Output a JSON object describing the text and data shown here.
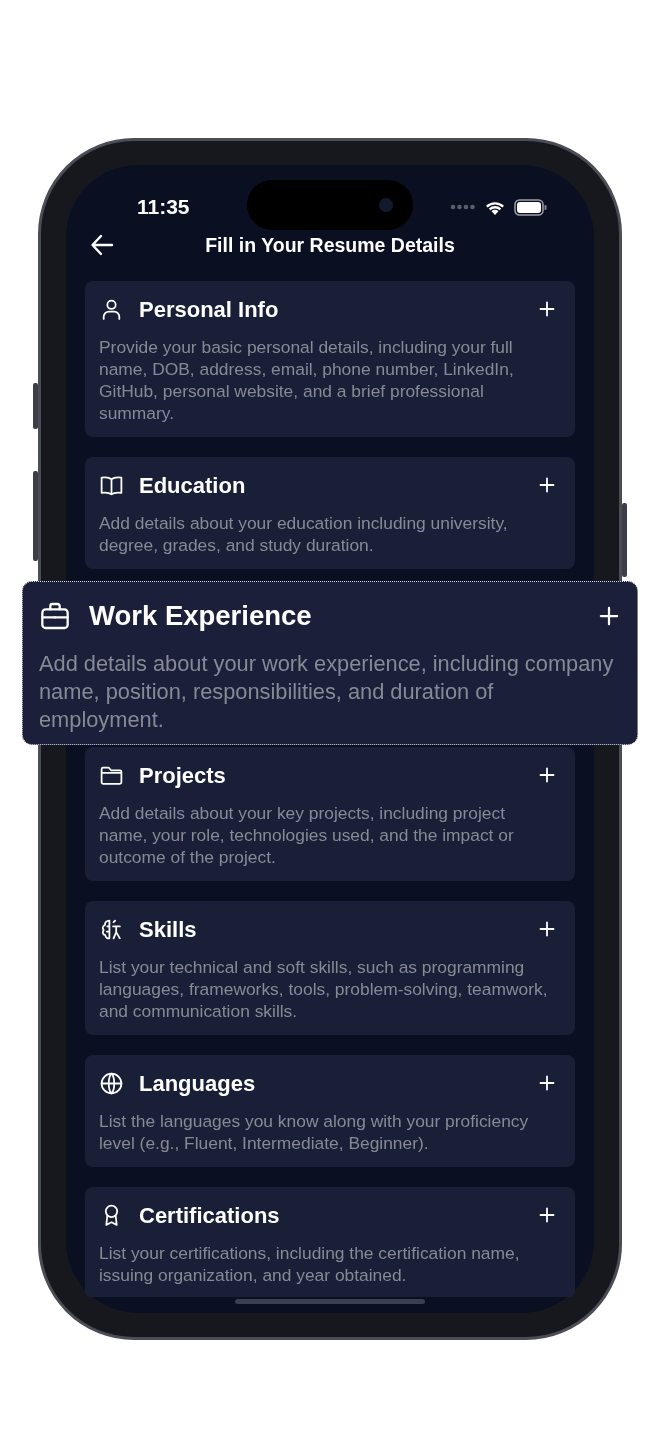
{
  "status_bar": {
    "time": "11:35"
  },
  "header": {
    "title": "Fill in Your Resume Details"
  },
  "sections": [
    {
      "title": "Personal Info",
      "description": "Provide your basic personal details, including your full name, DOB, address, email, phone number, LinkedIn, GitHub, personal website, and a brief professional summary.",
      "highlighted": false
    },
    {
      "title": "Education",
      "description": "Add details about your education including university, degree, grades, and study duration.",
      "highlighted": false
    },
    {
      "title": "Work Experience",
      "description": "Add details about your work experience, including company name, position, responsibilities, and duration of employment.",
      "highlighted": true
    },
    {
      "title": "Projects",
      "description": "Add details about your key projects, including project name, your role, technologies used, and the impact or outcome of the project.",
      "highlighted": false
    },
    {
      "title": "Skills",
      "description": "List your technical and soft skills, such as programming languages, frameworks, tools, problem-solving, teamwork, and communication skills.",
      "highlighted": false
    },
    {
      "title": "Languages",
      "description": "List the languages you know along with your proficiency level (e.g., Fluent, Intermediate, Beginner).",
      "highlighted": false
    },
    {
      "title": "Certifications",
      "description": "List your certifications, including the certification name, issuing organization, and year obtained.",
      "highlighted": false
    }
  ]
}
